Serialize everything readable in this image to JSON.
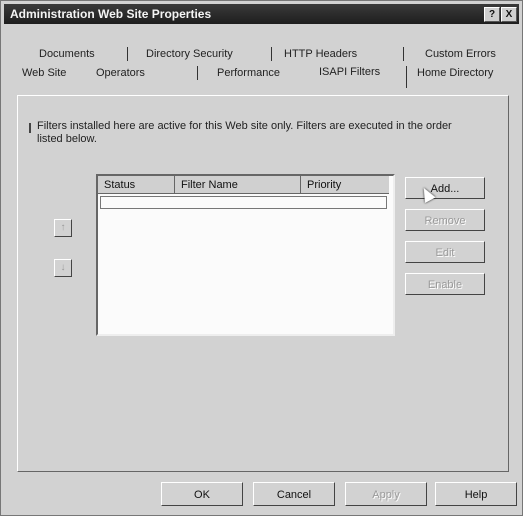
{
  "window": {
    "title": "Administration Web Site Properties",
    "help_glyph": "?",
    "close_glyph": "X"
  },
  "tabs": {
    "row1": [
      "Documents",
      "Directory Security",
      "HTTP Headers",
      "Custom Errors"
    ],
    "row2": [
      "Web Site",
      "Operators",
      "Performance",
      "ISAPI Filters",
      "Home Directory"
    ],
    "active": "ISAPI Filters"
  },
  "info_text": "Filters installed here are active for this Web site only. Filters are executed in the order listed below.",
  "filter_list": {
    "columns": [
      "Status",
      "Filter Name",
      "Priority"
    ],
    "rows": []
  },
  "side_buttons": {
    "add": "Add...",
    "remove": "Remove",
    "edit": "Edit",
    "enable": "Enable"
  },
  "arrows": {
    "up": "↑",
    "down": "↓"
  },
  "footer_buttons": {
    "ok": "OK",
    "cancel": "Cancel",
    "apply": "Apply",
    "help": "Help"
  }
}
